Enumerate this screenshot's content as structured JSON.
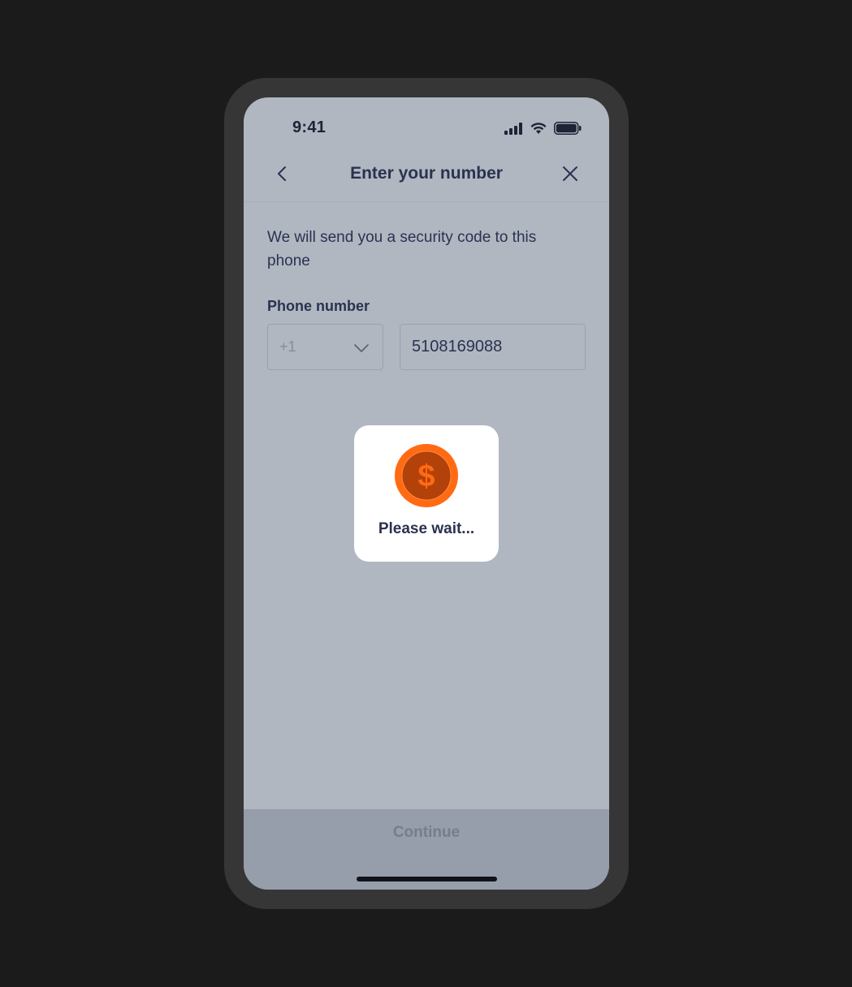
{
  "status_bar": {
    "time": "9:41",
    "icons": [
      "signal-icon",
      "wifi-icon",
      "battery-icon"
    ]
  },
  "nav": {
    "title": "Enter your number",
    "back_icon": "chevron-left-icon",
    "close_icon": "close-icon"
  },
  "content": {
    "intro": "We will send you a security code to this phone",
    "phone_label": "Phone number",
    "country_code": "+1",
    "country_chevron_icon": "chevron-down-icon",
    "phone_value": "5108169088"
  },
  "loading": {
    "icon": "dollar-coin-icon",
    "text": "Please wait..."
  },
  "footer": {
    "continue_label": "Continue"
  },
  "colors": {
    "background": "#1b1b1b",
    "frame": "#363636",
    "screen_overlay": "#b0b7c1",
    "text": "#2a3250",
    "coin_accent": "#ff6a13",
    "coin_inner": "#b3410a",
    "footer": "#969dab"
  }
}
